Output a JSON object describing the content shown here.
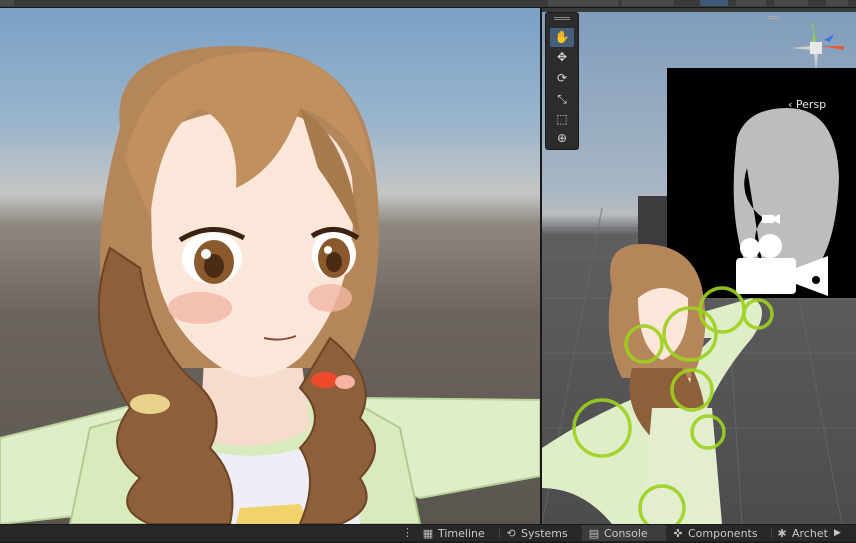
{
  "scene_view": {
    "perspective_label": "Persp",
    "tools": [
      {
        "icon": "hand-icon",
        "glyph": "✋",
        "active": true
      },
      {
        "icon": "move-icon",
        "glyph": "✥",
        "active": false
      },
      {
        "icon": "rotate-icon",
        "glyph": "⟳",
        "active": false
      },
      {
        "icon": "scale-icon",
        "glyph": "⤡",
        "active": false
      },
      {
        "icon": "rect-icon",
        "glyph": "⬚",
        "active": false
      },
      {
        "icon": "transform-icon",
        "glyph": "⊕",
        "active": false
      }
    ]
  },
  "bottom_tabs": [
    {
      "icon": "timeline-icon",
      "glyph": "▦",
      "label": "Timeline"
    },
    {
      "icon": "systems-icon",
      "glyph": "⟲",
      "label": "Systems"
    },
    {
      "icon": "console-icon",
      "glyph": "▤",
      "label": "Console"
    },
    {
      "icon": "components-icon",
      "glyph": "✜",
      "label": "Components"
    },
    {
      "icon": "archetypes-icon",
      "glyph": "✱",
      "label": "Archet"
    }
  ],
  "colors": {
    "panel_bg": "#282828",
    "active_tab": "#3c3c3c",
    "tool_active": "#46607c",
    "gizmo_x": "#e0603c",
    "gizmo_y": "#9ad04a",
    "gizmo_z": "#3c7ae0",
    "collider_green": "#9cd21c"
  }
}
